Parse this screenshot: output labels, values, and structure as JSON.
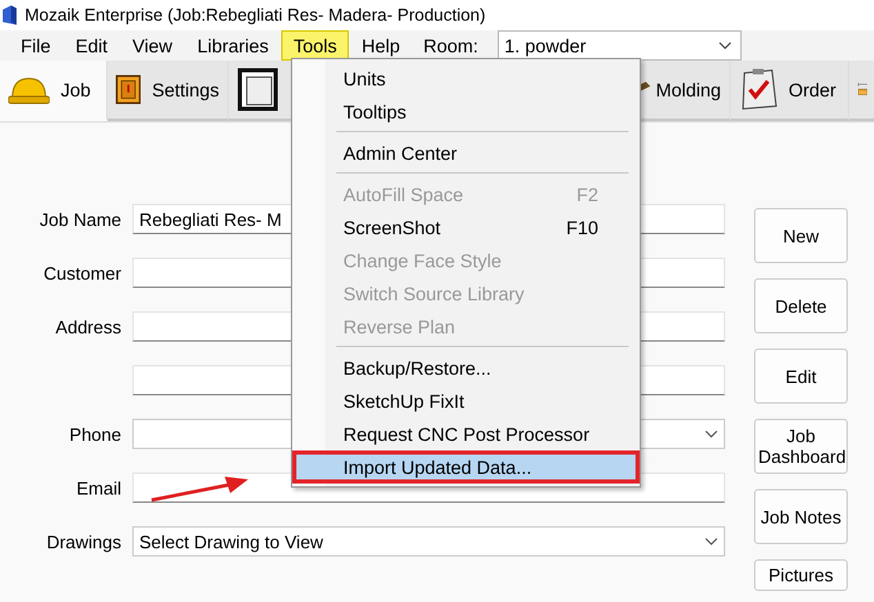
{
  "window": {
    "title": "Mozaik Enterprise (Job:Rebegliati Res- Madera- Production)"
  },
  "menu_bar": {
    "items": [
      {
        "label": "File",
        "selected": false
      },
      {
        "label": "Edit",
        "selected": false
      },
      {
        "label": "View",
        "selected": false
      },
      {
        "label": "Libraries",
        "selected": false
      },
      {
        "label": "Tools",
        "selected": true
      },
      {
        "label": "Help",
        "selected": false
      }
    ],
    "room_label": "Room:",
    "room_value": "1. powder"
  },
  "tabs": [
    {
      "kind": "job",
      "label": "Job",
      "selected": true
    },
    {
      "kind": "settings",
      "label": "Settings",
      "selected": false
    },
    {
      "kind": "frame",
      "selected": false
    },
    {
      "kind": "molding",
      "label": "Molding",
      "selected": false
    },
    {
      "kind": "order",
      "label": "Order",
      "selected": false
    },
    {
      "kind": "ruler",
      "selected": false
    }
  ],
  "form": {
    "fields": [
      {
        "kind": "text",
        "label": "Job Name",
        "value": "Rebegliati Res- M"
      },
      {
        "kind": "text",
        "label": "Customer"
      },
      {
        "kind": "text",
        "label": "Address"
      },
      {
        "kind": "text"
      },
      {
        "kind": "dropdown",
        "label": "Phone"
      },
      {
        "kind": "text",
        "label": "Email"
      },
      {
        "kind": "dropdown",
        "label": "Drawings",
        "value": "Select Drawing to View"
      }
    ],
    "buttons": [
      "New",
      "Delete",
      "Edit",
      "Job Dashboard",
      "Job Notes",
      "Pictures"
    ]
  },
  "tools_menu": {
    "items": [
      {
        "kind": "item",
        "label": "Units",
        "disabled": false,
        "selected": false
      },
      {
        "kind": "item",
        "label": "Tooltips",
        "disabled": false,
        "selected": false
      },
      {
        "kind": "separator"
      },
      {
        "kind": "item",
        "label": "Admin Center",
        "disabled": false,
        "selected": false
      },
      {
        "kind": "separator"
      },
      {
        "kind": "item",
        "label": "AutoFill Space",
        "shortcut": "F2",
        "disabled": true,
        "selected": false
      },
      {
        "kind": "item",
        "label": "ScreenShot",
        "shortcut": "F10",
        "disabled": false,
        "selected": false
      },
      {
        "kind": "item",
        "label": "Change Face Style",
        "disabled": true,
        "selected": false
      },
      {
        "kind": "item",
        "label": "Switch Source Library",
        "disabled": true,
        "selected": false
      },
      {
        "kind": "item",
        "label": "Reverse Plan",
        "disabled": true,
        "selected": false
      },
      {
        "kind": "separator"
      },
      {
        "kind": "item",
        "label": "Backup/Restore...",
        "disabled": false,
        "selected": false
      },
      {
        "kind": "item",
        "label": "SketchUp FixIt",
        "disabled": false,
        "selected": false
      },
      {
        "kind": "item",
        "label": "Request CNC Post Processor",
        "disabled": false,
        "selected": false
      },
      {
        "kind": "item",
        "label": "Import Updated Data...",
        "disabled": false,
        "selected": true
      }
    ]
  }
}
